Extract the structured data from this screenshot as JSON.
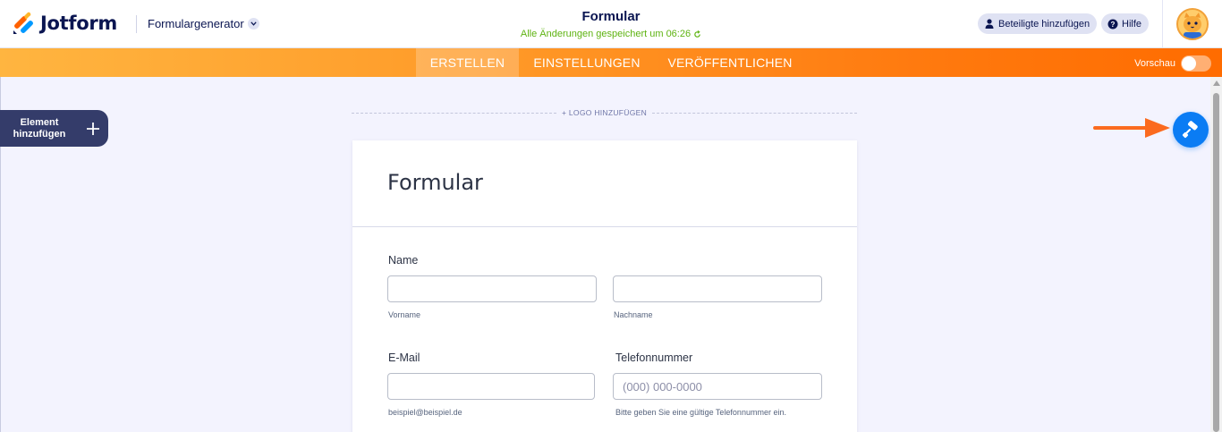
{
  "app": {
    "brand_name": "Jotform",
    "product_menu": "Formulargenerator",
    "form_name": "Formular",
    "save_status": "Alle Änderungen gespeichert um 06:26",
    "add_participants_label": "Beteiligte hinzufügen",
    "help_label": "Hilfe"
  },
  "tabs": [
    {
      "label": "ERSTELLEN",
      "active": true
    },
    {
      "label": "EINSTELLUNGEN",
      "active": false
    },
    {
      "label": "VERÖFFENTLICHEN",
      "active": false
    }
  ],
  "preview": {
    "label": "Vorschau",
    "on": false
  },
  "sidebar": {
    "add_element_line1": "Element",
    "add_element_line2": "hinzufügen"
  },
  "logo_add_label": "+ LOGO HINZUFÜGEN",
  "form": {
    "title": "Formular",
    "name": {
      "label": "Name",
      "first_sublabel": "Vorname",
      "last_sublabel": "Nachname",
      "first_value": "",
      "last_value": ""
    },
    "email": {
      "label": "E-Mail",
      "sublabel": "beispiel@beispiel.de",
      "value": ""
    },
    "phone": {
      "label": "Telefonnummer",
      "placeholder": "(000) 000-0000",
      "sublabel": "Bitte geben Sie eine gültige Telefonnummer ein."
    }
  },
  "icons": {
    "logo": "jotform-logo-icon",
    "product_chevron": "chevron-down-icon",
    "refresh": "refresh-icon",
    "user": "user-icon",
    "help": "question-circle-icon",
    "avatar": "cat-avatar-icon",
    "plus": "plus-icon",
    "theme": "paint-roller-icon",
    "arrow": "arrow-right-icon"
  },
  "colors": {
    "navy": "#0a1551",
    "orange_start": "#ffb540",
    "orange_end": "#ff6c00",
    "saved_green": "#5eb311",
    "theme_blue": "#0a7cf4",
    "annotation_orange": "#fb6a1f"
  }
}
